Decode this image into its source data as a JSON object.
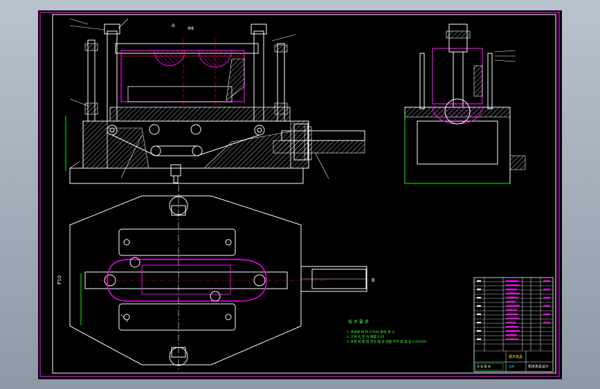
{
  "drawing": {
    "top_view_mark": "Ф8",
    "section_mark": "A",
    "right_mark": "B",
    "side_mark": "Р10"
  },
  "notes": {
    "heading": "技 术 要 求",
    "lines": [
      "1. 夹具体 材 料 HT200 铸造 退 火",
      "2. 工件 孔 定 位 精度 0.05",
      "3. 夹具 装 配 后 定位 面 对 底面 平行 度 误 差 0.02/100"
    ]
  },
  "title_block": {
    "part_name": "拨叉夹具",
    "school": "机床夹具设计",
    "scale_label": "比例",
    "sheet_label": "共 张 第 张"
  },
  "colors": {
    "background": "#000000",
    "line": "#ffffff",
    "part": "#ff00ff",
    "hatch": "#ffffff",
    "cyan": "#00ffff",
    "green": "#00ff00",
    "frame": "#ff00ff",
    "canvas": "#b9c3cd"
  }
}
